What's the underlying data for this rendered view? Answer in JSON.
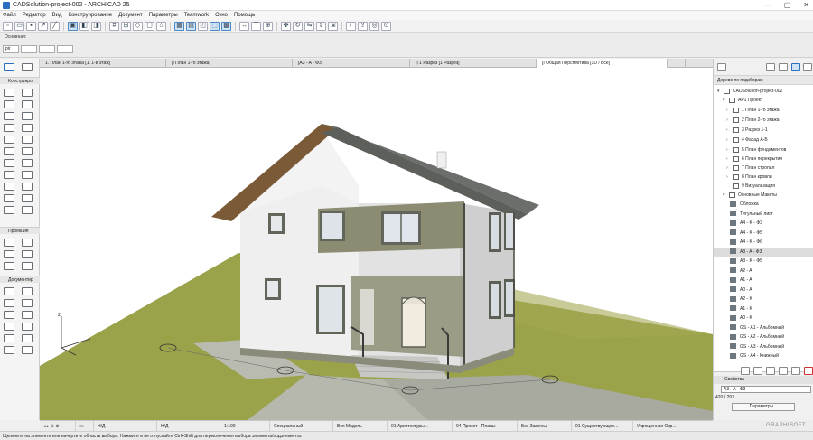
{
  "window": {
    "title": "CADSolution-project-002 - ARCHICAD 25",
    "controls": [
      "—",
      "▢",
      "✕"
    ]
  },
  "menu": [
    "Файл",
    "Редактор",
    "Вид",
    "Конструирование",
    "Документ",
    "Параметры",
    "Teamwork",
    "Окно",
    "Помощь"
  ],
  "infobox": {
    "label": "Основная:",
    "selection_value": "pir"
  },
  "tabs": [
    {
      "label": "1. План 1-го этажа [1. 1-й этаж]",
      "active": false
    },
    {
      "label": "[I План 1-го этажа]",
      "active": false
    },
    {
      "label": "[A3 - A - Ф3]",
      "active": false
    },
    {
      "label": "[I 1 Разрез [1 Разрез]",
      "active": false
    },
    {
      "label": "[I Общая Перспектива [3D / Все]",
      "active": true
    }
  ],
  "toolbox": {
    "sections": [
      "Конструиро",
      "Проекция",
      "Документир"
    ]
  },
  "navigator": {
    "selector": "Дерево по подкборам",
    "project": "CADSolution-project-002",
    "group1": "АР1 Проект",
    "items1": [
      "1 План 1-го этажа",
      "2 План 2-го этажа",
      "3 Разрез 1-1",
      "4 Фасад А-Б",
      "5 План фундаментов",
      "6 План перекрытия",
      "7 План стропил",
      "8 План кровли",
      "9 Визуализация"
    ],
    "group2": "Основные Макеты",
    "items2": [
      "Обложка",
      "Титульный лист",
      "A4 - K - Ф3",
      "A4 - K - Ф5",
      "A4 - K - Ф6",
      "A3 - A - Ф3",
      "A3 - K - Ф5",
      "A2 - A",
      "A1 - A",
      "A0 - A",
      "A2 - K",
      "A1 - K",
      "A0 - K",
      "GS - A1 - Альбомный",
      "GS - A2 - Альбомный",
      "GS - A3 - Альбомный",
      "GS - A4 - Книжный"
    ],
    "selected": "A3 - A - Ф3"
  },
  "properties": {
    "header": "Свойства",
    "field": "A3 - A - Ф3",
    "size": "420 / 297",
    "button": "Параметры..."
  },
  "viewstatus": [
    "Н/Д",
    "Н/Д",
    "1:100",
    "Специальный",
    "Вся Модель",
    "01 Архитектуры...",
    "04 Проект - Планы",
    "Без Замены",
    "01 Существующее...",
    "Упрощенная Окр..."
  ],
  "status_message": "Щелкните на элементе или начертите область выбора. Нажмите и не отпускайте Ctrl+Shift для переключения выбора элемента/подэлемента.",
  "brand": "GRAPHISOFT",
  "axis_label": "z"
}
